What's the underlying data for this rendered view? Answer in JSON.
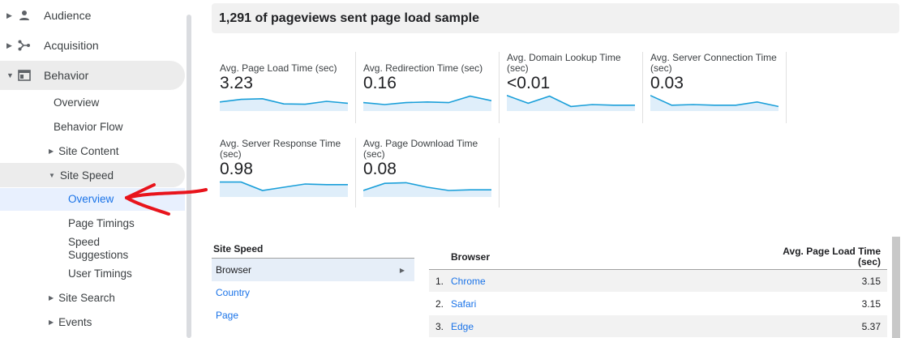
{
  "sidebar": {
    "top_items": [
      {
        "label": "Audience",
        "icon": "person-icon"
      },
      {
        "label": "Acquisition",
        "icon": "acquisition-icon"
      },
      {
        "label": "Behavior",
        "icon": "behavior-icon"
      }
    ],
    "behavior_sub": {
      "overview": "Overview",
      "behavior_flow": "Behavior Flow",
      "site_content": "Site Content",
      "site_speed": "Site Speed",
      "site_speed_children": {
        "overview": "Overview",
        "page_timings": "Page Timings",
        "speed_suggestions": "Speed Suggestions",
        "user_timings": "User Timings"
      },
      "site_search": "Site Search",
      "events": "Events"
    }
  },
  "header": {
    "title": "1,291 of pageviews sent page load sample"
  },
  "metrics": [
    {
      "label": "Avg. Page Load Time (sec)",
      "value": "3.23",
      "spark": [
        0.55,
        0.35,
        0.3,
        0.7,
        0.72,
        0.5,
        0.65
      ]
    },
    {
      "label": "Avg. Redirection Time (sec)",
      "value": "0.16",
      "spark": [
        0.6,
        0.75,
        0.6,
        0.55,
        0.6,
        0.1,
        0.45
      ]
    },
    {
      "label": "Avg. Domain Lookup Time (sec)",
      "value": "<0.01",
      "spark": [
        0.05,
        0.65,
        0.1,
        0.9,
        0.75,
        0.8,
        0.8
      ]
    },
    {
      "label": "Avg. Server Connection Time (sec)",
      "value": "0.03",
      "spark": [
        0.05,
        0.8,
        0.75,
        0.8,
        0.8,
        0.55,
        0.9
      ]
    },
    {
      "label": "Avg. Server Response Time (sec)",
      "value": "0.98",
      "spark": [
        0.1,
        0.1,
        0.75,
        0.5,
        0.25,
        0.3,
        0.3
      ]
    },
    {
      "label": "Avg. Page Download Time (sec)",
      "value": "0.08",
      "spark": [
        0.75,
        0.2,
        0.15,
        0.5,
        0.75,
        0.7,
        0.7
      ]
    }
  ],
  "site_speed": {
    "title": "Site Speed",
    "rows": [
      "Browser",
      "Country",
      "Page"
    ]
  },
  "browser_table": {
    "col_browser": "Browser",
    "col_metric_line1": "Avg. Page Load Time",
    "col_metric_line2": "(sec)",
    "rows": [
      {
        "num": "1.",
        "name": "Chrome",
        "value": "3.15"
      },
      {
        "num": "2.",
        "name": "Safari",
        "value": "3.15"
      },
      {
        "num": "3.",
        "name": "Edge",
        "value": "5.37"
      }
    ]
  },
  "colors": {
    "spark_line": "#1a9fd9",
    "spark_fill": "#dfeefa",
    "annotation_arrow": "#e8141c",
    "link": "#1a73e8"
  }
}
